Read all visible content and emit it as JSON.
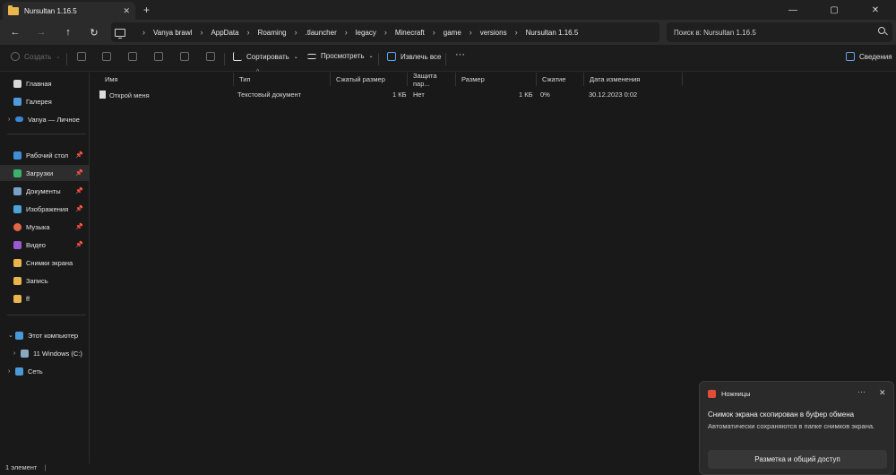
{
  "window": {
    "tab_title": "Nursultan 1.16.5",
    "tab_close": "✕",
    "new_tab": "+",
    "minimize": "—",
    "maximize": "▢",
    "close": "✕"
  },
  "nav": {
    "back": "←",
    "forward": "→",
    "up": "↑",
    "refresh": "↻"
  },
  "breadcrumb": [
    "Vanya brawl",
    "AppData",
    "Roaming",
    ".tlauncher",
    "legacy",
    "Minecraft",
    "game",
    "versions",
    "Nursultan 1.16.5"
  ],
  "search": {
    "placeholder": "Поиск в: Nursultan 1.16.5"
  },
  "commands": {
    "create": "Создать",
    "sort": "Сортировать",
    "view": "Просмотреть",
    "extract_all": "Извлечь все",
    "more": "···",
    "details": "Сведения"
  },
  "sidebar": {
    "items": [
      {
        "label": "Главная",
        "icon": "home-icon"
      },
      {
        "label": "Галерея",
        "icon": "gallery-icon"
      },
      {
        "label": "Vanya — Личное",
        "icon": "onedrive-icon"
      },
      {
        "label": "Рабочий стол",
        "icon": "desktop-icon"
      },
      {
        "label": "Загрузки",
        "icon": "download-icon"
      },
      {
        "label": "Документы",
        "icon": "documents-icon"
      },
      {
        "label": "Изображения",
        "icon": "pictures-icon"
      },
      {
        "label": "Музыка",
        "icon": "music-icon"
      },
      {
        "label": "Видео",
        "icon": "video-icon"
      },
      {
        "label": "Снимки экрана",
        "icon": "folder-icon"
      },
      {
        "label": "Запись",
        "icon": "folder-icon"
      },
      {
        "label": "ff",
        "icon": "folder-icon"
      },
      {
        "label": "Этот компьютер",
        "icon": "pc-icon"
      },
      {
        "label": "11 Windows (C:)",
        "icon": "drive-icon"
      },
      {
        "label": "Сеть",
        "icon": "network-icon"
      }
    ]
  },
  "columns": [
    "Имя",
    "Тип",
    "Сжатый размер",
    "Защита пар...",
    "Размер",
    "Сжатие",
    "Дата изменения"
  ],
  "files": [
    {
      "name": "Открой меня",
      "type": "Текстовый документ",
      "compressed": "1 КБ",
      "protected": "Нет",
      "size": "1 КБ",
      "ratio": "0%",
      "modified": "30.12.2023 0:02"
    }
  ],
  "status": {
    "count": "1 элемент"
  },
  "toast": {
    "app": "Ножницы",
    "more": "···",
    "close": "✕",
    "heading": "Снимок экрана скопирован в буфер обмена",
    "body": "Автоматически сохраняются в папке снимков экрана.",
    "button": "Разметка и общий доступ"
  },
  "colors": {
    "folder": "#e8b64a",
    "background": "#191919",
    "toast_icon": "#e04e3a"
  }
}
